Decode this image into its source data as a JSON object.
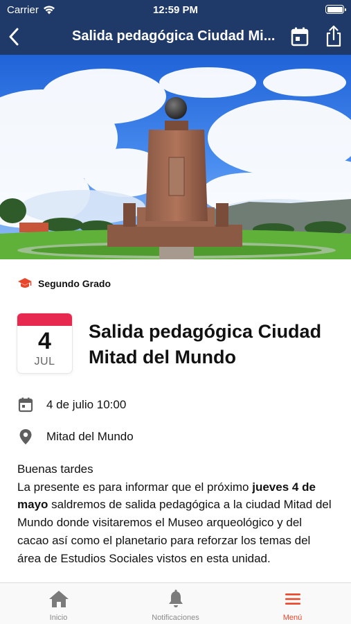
{
  "status_bar": {
    "carrier": "Carrier",
    "time": "12:59 PM"
  },
  "nav": {
    "title": "Salida pedagógica Ciudad Mi..."
  },
  "event": {
    "grade": "Segundo Grado",
    "day": "4",
    "month": "JUL",
    "title": "Salida pedagógica Ciudad Mitad del Mundo",
    "datetime": "4 de julio 10:00",
    "location": "Mitad del Mundo",
    "body": {
      "greeting": "Buenas tardes",
      "p1": "La presente es para informar que el próximo ",
      "highlight": "jueves 4 de mayo",
      "p2": " saldremos de salida pedagógica a la ciudad Mitad del Mundo donde visitaremos el Museo arqueológico y del cacao así como el planetario para reforzar los temas del área de Estudios Sociales vistos en esta unidad."
    }
  },
  "tabs": [
    {
      "label": "Inicio",
      "icon": "home-icon"
    },
    {
      "label": "Notificaciones",
      "icon": "bell-icon"
    },
    {
      "label": "Menú",
      "icon": "menu-icon"
    }
  ],
  "colors": {
    "nav_bg": "#1f3a68",
    "accent": "#e8462a",
    "date_band": "#e8294f"
  }
}
